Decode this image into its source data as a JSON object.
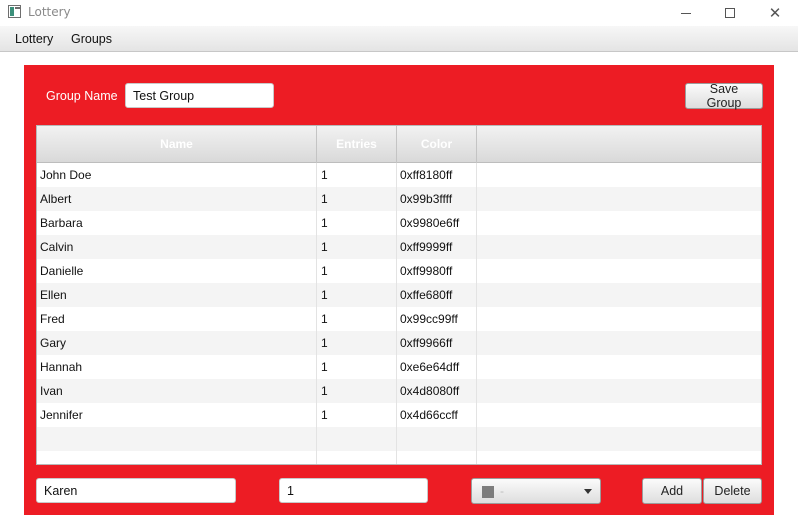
{
  "window": {
    "title": "Lottery",
    "icon": "app-window-icon",
    "controls": {
      "minimize": "minimize-icon",
      "maximize": "maximize-icon",
      "close": "close-icon"
    }
  },
  "menubar": {
    "items": [
      "Lottery",
      "Groups"
    ]
  },
  "group": {
    "label": "Group Name",
    "name_value": "Test Group",
    "save_label": "Save Group",
    "panel_color": "#ed1c24"
  },
  "table": {
    "columns": [
      "Name",
      "Entries",
      "Color"
    ],
    "rows": [
      {
        "name": "John Doe",
        "entries": "1",
        "color": "0xff8180ff"
      },
      {
        "name": "Albert",
        "entries": "1",
        "color": "0x99b3ffff"
      },
      {
        "name": "Barbara",
        "entries": "1",
        "color": "0x9980e6ff"
      },
      {
        "name": "Calvin",
        "entries": "1",
        "color": "0xff9999ff"
      },
      {
        "name": "Danielle",
        "entries": "1",
        "color": "0xff9980ff"
      },
      {
        "name": "Ellen",
        "entries": "1",
        "color": "0xffe680ff"
      },
      {
        "name": "Fred",
        "entries": "1",
        "color": "0x99cc99ff"
      },
      {
        "name": "Gary",
        "entries": "1",
        "color": "0xff9966ff"
      },
      {
        "name": "Hannah",
        "entries": "1",
        "color": "0xe6e64dff"
      },
      {
        "name": "Ivan",
        "entries": "1",
        "color": "0x4d8080ff"
      },
      {
        "name": "Jennifer",
        "entries": "1",
        "color": "0x4d66ccff"
      }
    ]
  },
  "entry_form": {
    "name_value": "Karen",
    "entries_value": "1",
    "color_value": "-",
    "color_swatch": "#7d7d7d",
    "add_label": "Add",
    "delete_label": "Delete"
  }
}
